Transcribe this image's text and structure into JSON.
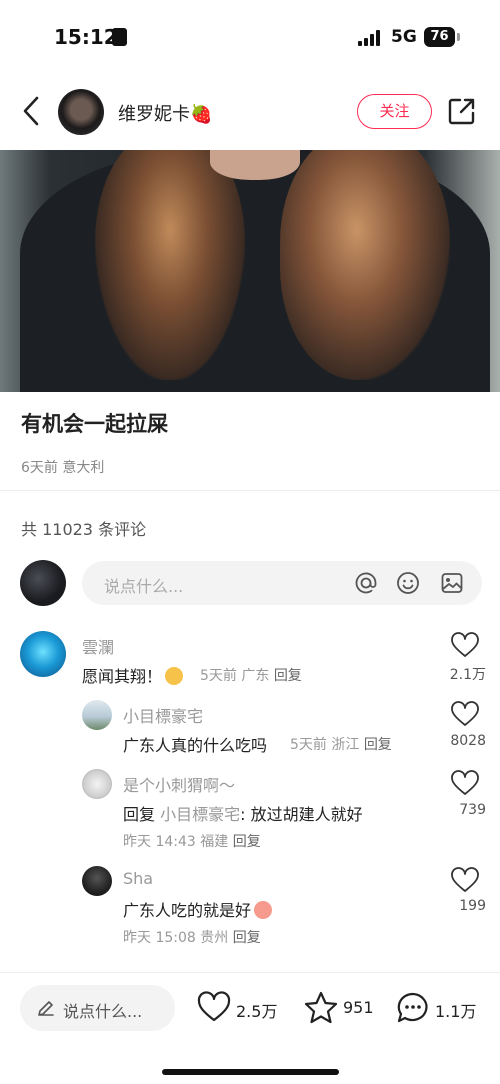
{
  "status": {
    "time": "15:12",
    "network": "5G",
    "battery": "76"
  },
  "author": {
    "name": "维罗妮卡🍓",
    "follow_label": "关注"
  },
  "post": {
    "title": "有机会一起拉屎",
    "meta": "6天前 意大利"
  },
  "comments_header": {
    "count_text": "共 11023 条评论",
    "input_placeholder": "说点什么..."
  },
  "comments": [
    {
      "name": "雲瀾",
      "text": "愿闻其翔！",
      "meta": "5天前 广东",
      "reply": "回复",
      "likes": "2.1万"
    },
    {
      "name": "小目標豪宅",
      "text": "广东人真的什么吃吗",
      "meta": "5天前 浙江",
      "reply": "回复",
      "likes": "8028"
    },
    {
      "name": "是个小刺猬啊～",
      "text_prefix": "回复 ",
      "mention": "小目標豪宅",
      "text_suffix": ": 放过胡建人就好",
      "meta": "昨天 14:43 福建",
      "reply": "回复",
      "likes": "739"
    },
    {
      "name": "Sha",
      "text": "广东人吃的就是好",
      "meta": "昨天 15:08 贵州",
      "reply": "回复",
      "likes": "199"
    }
  ],
  "bottom_bar": {
    "placeholder": "说点什么...",
    "likes": "2.5万",
    "favorites": "951",
    "comments": "1.1万"
  },
  "colors": {
    "accent": "#ff2b52"
  },
  "icons": [
    "back-icon",
    "share-icon",
    "at-icon",
    "emoji-icon",
    "image-icon",
    "heart-icon",
    "star-icon",
    "comment-icon",
    "pen-icon"
  ]
}
